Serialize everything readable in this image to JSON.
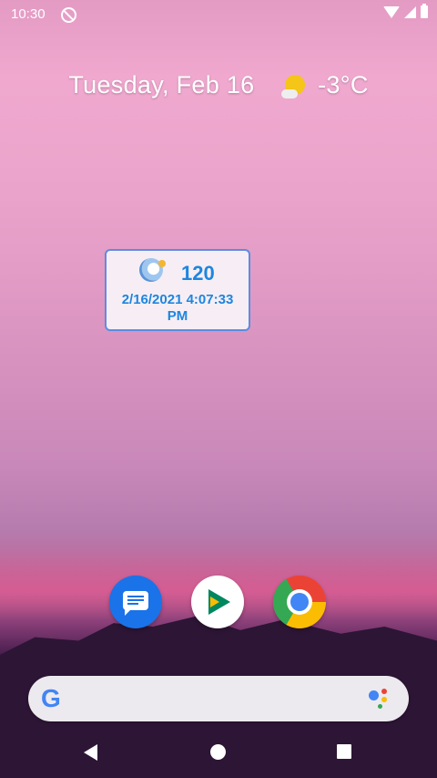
{
  "status_bar": {
    "time": "10:30"
  },
  "home": {
    "date": "Tuesday, Feb 16",
    "temperature": "-3°C"
  },
  "widget": {
    "count": "120",
    "datetime": "2/16/2021 4:07:33 PM"
  },
  "dock": {
    "apps": [
      "Messages",
      "Play Store",
      "Chrome"
    ]
  },
  "search": {
    "logo": "G"
  },
  "colors": {
    "widget_text": "#1c86e0",
    "widget_border": "#5c8ce0"
  }
}
